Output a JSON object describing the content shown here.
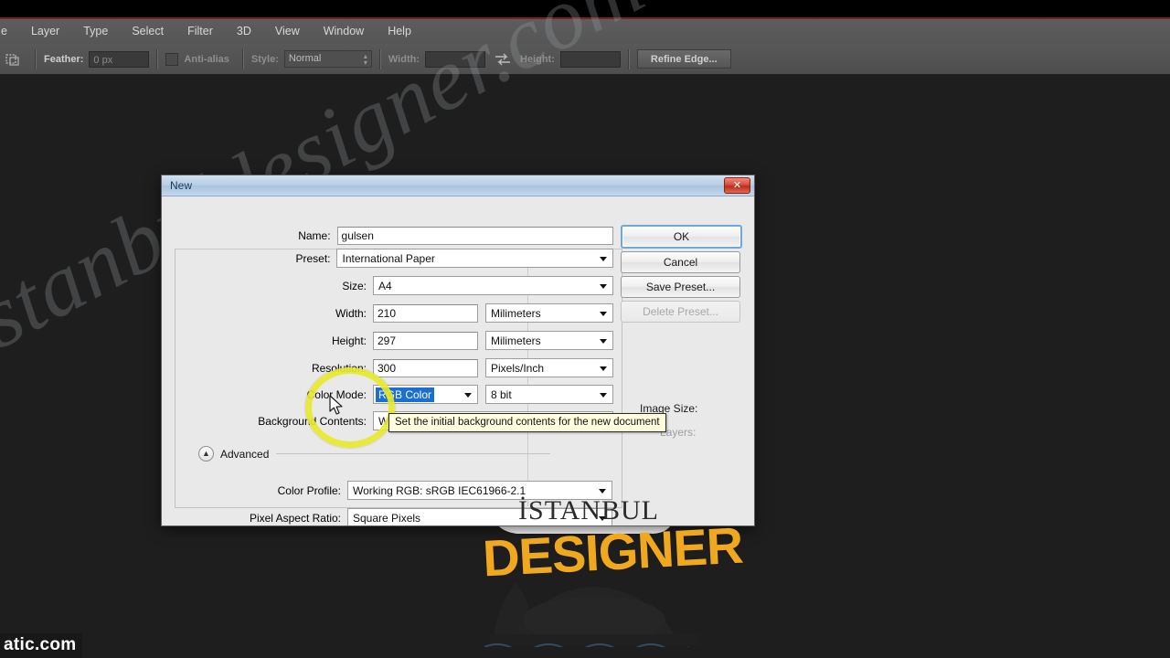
{
  "app": {
    "menubar": [
      "e",
      "Layer",
      "Type",
      "Select",
      "Filter",
      "3D",
      "View",
      "Window",
      "Help"
    ],
    "options_bar": {
      "tool_icon": "marquee-tool-icon",
      "feather_label": "Feather:",
      "feather_value": "0 px",
      "antialias_label": "Anti-alias",
      "style_label": "Style:",
      "style_value": "Normal",
      "width_label": "Width:",
      "width_value": "",
      "swap_icon": "swap-dimensions-icon",
      "height_label": "Height:",
      "height_value": "",
      "refine_edge_label": "Refine Edge..."
    }
  },
  "dialog": {
    "title": "New",
    "close_label": "✕",
    "fields": {
      "name_label": "Name:",
      "name_value": "gulsen",
      "preset_label": "Preset:",
      "preset_value": "International Paper",
      "size_label": "Size:",
      "size_value": "A4",
      "width_label": "Width:",
      "width_value": "210",
      "width_unit": "Milimeters",
      "height_label": "Height:",
      "height_value": "297",
      "height_unit": "Milimeters",
      "resolution_label": "Resolution:",
      "resolution_value": "300",
      "resolution_unit": "Pixels/Inch",
      "color_mode_label": "Color Mode:",
      "color_mode_value": "RGB Color",
      "color_depth_value": "8 bit",
      "background_label": "Background Contents:",
      "background_value": "White"
    },
    "advanced": {
      "toggle_icon": "chevron-up-icon",
      "label": "Advanced",
      "color_profile_label": "Color Profile:",
      "color_profile_value": "Working RGB:  sRGB IEC61966-2.1",
      "pixel_aspect_label": "Pixel Aspect Ratio:",
      "pixel_aspect_value": "Square Pixels"
    },
    "buttons": {
      "ok": "OK",
      "cancel": "Cancel",
      "save_preset": "Save Preset...",
      "delete_preset": "Delete Preset..."
    },
    "image_size_label": "Image Size:",
    "layers_ghost": "Layers:"
  },
  "tooltip": {
    "text": "Set the initial background contents for the new document"
  },
  "annotations": {
    "circle_color": "#e8ea2a",
    "cursor_icon": "mouse-pointer-icon"
  },
  "watermark": {
    "diagonal_text": "istanbuldesigner.com",
    "bottom_left_text": "atic.com",
    "logo_top": "İSTANBUL",
    "logo_bottom": "DESIGNER"
  },
  "colors": {
    "accent_blue": "#1a6fd4",
    "highlight_yellow": "#e8ea2a",
    "logo_orange": "#f0a81e",
    "title_red": "#7a2222"
  }
}
